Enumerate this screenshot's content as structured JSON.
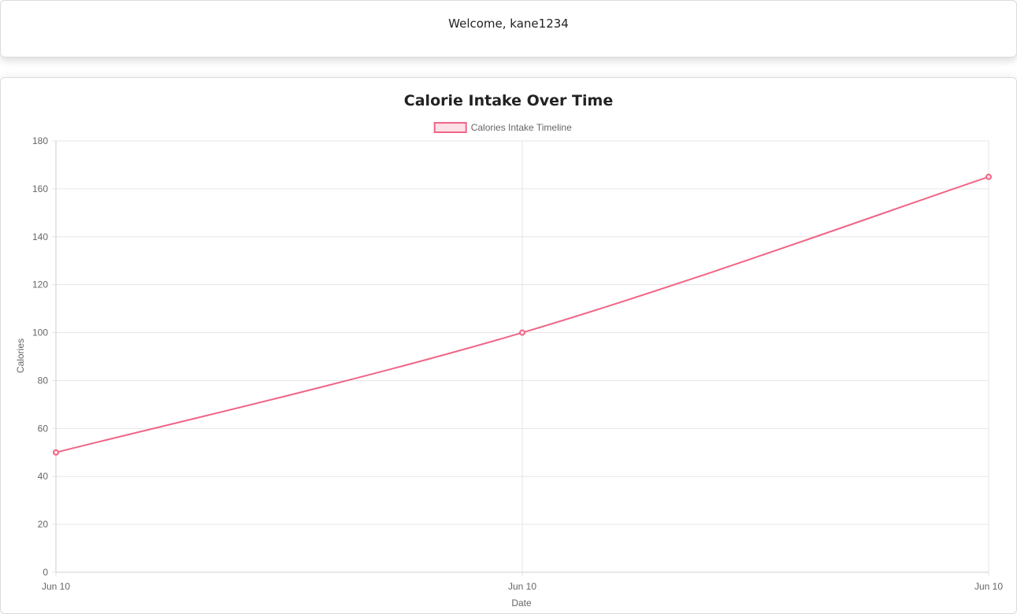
{
  "header": {
    "welcome_text": "Welcome, kane1234"
  },
  "colors": {
    "series_line": "#f06587",
    "series_fill": "#fde0e6",
    "grid": "#e6e6e6",
    "axis_text": "#666666"
  },
  "chart_data": {
    "type": "line",
    "title": "Calorie Intake Over Time",
    "xlabel": "Date",
    "ylabel": "Calories",
    "legend_position": "top",
    "grid": true,
    "ylim": [
      0,
      180
    ],
    "y_ticks": [
      0,
      20,
      40,
      60,
      80,
      100,
      120,
      140,
      160,
      180
    ],
    "x_tick_labels": [
      "Jun 10",
      "Jun 10",
      "Jun 10"
    ],
    "series": [
      {
        "name": "Calories Intake Timeline",
        "values": [
          50,
          100,
          165
        ]
      }
    ]
  }
}
